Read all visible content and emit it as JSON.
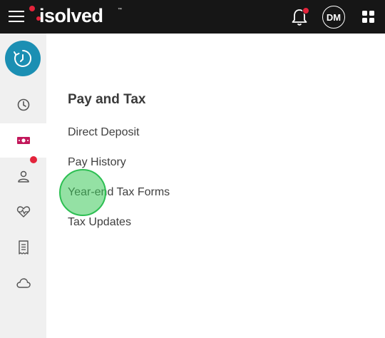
{
  "brand": {
    "logo_text": "isolved",
    "trademark": "™",
    "accent": "#e3243b"
  },
  "header": {
    "avatar_initials": "DM",
    "icons": [
      "menu-icon",
      "bell-icon",
      "apps-grid-icon"
    ]
  },
  "sidebar": {
    "primary_icon": "clock-arrow-icon",
    "primary_color": "#1b8fb3",
    "items": [
      {
        "icon": "clock-icon",
        "active": false
      },
      {
        "icon": "money-icon",
        "active": true,
        "color": "#c2185b"
      },
      {
        "icon": "person-icon",
        "active": false,
        "badge": true
      },
      {
        "icon": "heart-pulse-icon",
        "active": false
      },
      {
        "icon": "receipt-icon",
        "active": false
      },
      {
        "icon": "cloud-icon",
        "active": false
      }
    ]
  },
  "main": {
    "section_title": "Pay and Tax",
    "links": [
      {
        "label": "Direct Deposit"
      },
      {
        "label": "Pay History"
      },
      {
        "label": "Year-end Tax Forms"
      },
      {
        "label": "Tax Updates"
      }
    ]
  }
}
